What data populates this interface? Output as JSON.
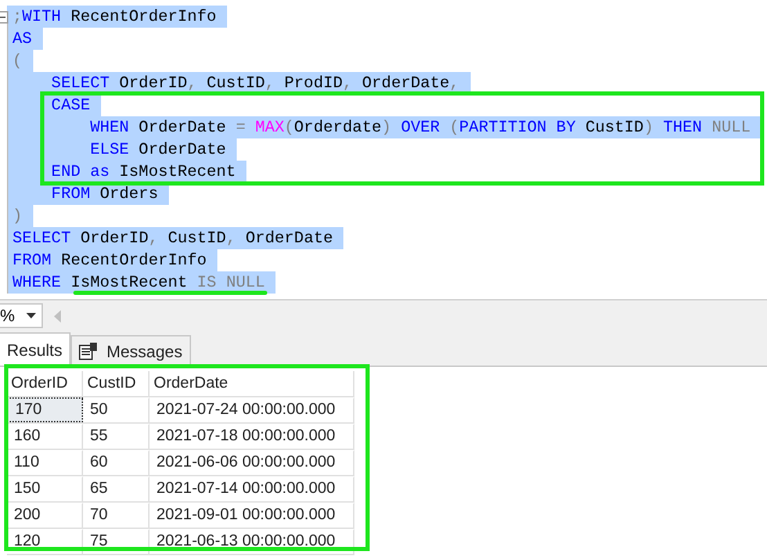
{
  "editor": {
    "lines": [
      [
        {
          "kind": "op",
          "text": ";"
        },
        {
          "kind": "kw",
          "text": "WITH"
        },
        {
          "kind": "plain",
          "text": " RecentOrderInfo"
        }
      ],
      [
        {
          "kind": "kw",
          "text": "AS"
        }
      ],
      [
        {
          "kind": "op",
          "text": "("
        }
      ],
      [
        {
          "kind": "kw",
          "text": "    SELECT"
        },
        {
          "kind": "plain",
          "text": " OrderID"
        },
        {
          "kind": "op",
          "text": ","
        },
        {
          "kind": "plain",
          "text": " CustID"
        },
        {
          "kind": "op",
          "text": ","
        },
        {
          "kind": "plain",
          "text": " ProdID"
        },
        {
          "kind": "op",
          "text": ","
        },
        {
          "kind": "plain",
          "text": " OrderDate"
        },
        {
          "kind": "op",
          "text": ","
        }
      ],
      [
        {
          "kind": "kw",
          "text": "    CASE"
        }
      ],
      [
        {
          "kind": "kw",
          "text": "        WHEN"
        },
        {
          "kind": "plain",
          "text": " OrderDate "
        },
        {
          "kind": "op",
          "text": "= "
        },
        {
          "kind": "fn",
          "text": "MAX"
        },
        {
          "kind": "op",
          "text": "("
        },
        {
          "kind": "plain",
          "text": "Orderdate"
        },
        {
          "kind": "op",
          "text": ") "
        },
        {
          "kind": "kw",
          "text": "OVER "
        },
        {
          "kind": "op",
          "text": "("
        },
        {
          "kind": "kw",
          "text": "PARTITION BY"
        },
        {
          "kind": "plain",
          "text": " CustID"
        },
        {
          "kind": "op",
          "text": ") "
        },
        {
          "kind": "kw",
          "text": "THEN "
        },
        {
          "kind": "op",
          "text": "NULL"
        }
      ],
      [
        {
          "kind": "kw",
          "text": "        ELSE"
        },
        {
          "kind": "plain",
          "text": " OrderDate"
        }
      ],
      [
        {
          "kind": "kw",
          "text": "    END as"
        },
        {
          "kind": "plain",
          "text": " IsMostRecent"
        }
      ],
      [
        {
          "kind": "kw",
          "text": "    FROM"
        },
        {
          "kind": "plain",
          "text": " Orders"
        }
      ],
      [
        {
          "kind": "op",
          "text": ")"
        }
      ],
      [
        {
          "kind": "kw",
          "text": "SELECT"
        },
        {
          "kind": "plain",
          "text": " OrderID"
        },
        {
          "kind": "op",
          "text": ","
        },
        {
          "kind": "plain",
          "text": " CustID"
        },
        {
          "kind": "op",
          "text": ","
        },
        {
          "kind": "plain",
          "text": " OrderDate"
        }
      ],
      [
        {
          "kind": "kw",
          "text": "FROM"
        },
        {
          "kind": "plain",
          "text": " RecentOrderInfo"
        }
      ],
      [
        {
          "kind": "kw",
          "text": "WHERE"
        },
        {
          "kind": "plain",
          "text": " IsMostRecent "
        },
        {
          "kind": "op",
          "text": "IS NULL"
        }
      ]
    ]
  },
  "zoom": {
    "value": "%"
  },
  "tabs": [
    {
      "label": "Results",
      "selected": true
    },
    {
      "label": "Messages",
      "selected": false
    }
  ],
  "grid": {
    "columns": [
      "OrderID",
      "CustID",
      "OrderDate"
    ],
    "rows": [
      {
        "cells": [
          "170",
          "50",
          "2021-07-24 00:00:00.000"
        ],
        "focused": true
      },
      {
        "cells": [
          "160",
          "55",
          "2021-07-18 00:00:00.000"
        ],
        "focused": false
      },
      {
        "cells": [
          "110",
          "60",
          "2021-06-06 00:00:00.000"
        ],
        "focused": false
      },
      {
        "cells": [
          "150",
          "65",
          "2021-07-14 00:00:00.000"
        ],
        "focused": false
      },
      {
        "cells": [
          "200",
          "70",
          "2021-09-01 00:00:00.000"
        ],
        "focused": false
      },
      {
        "cells": [
          "120",
          "75",
          "2021-06-13 00:00:00.000"
        ],
        "focused": false
      }
    ]
  }
}
